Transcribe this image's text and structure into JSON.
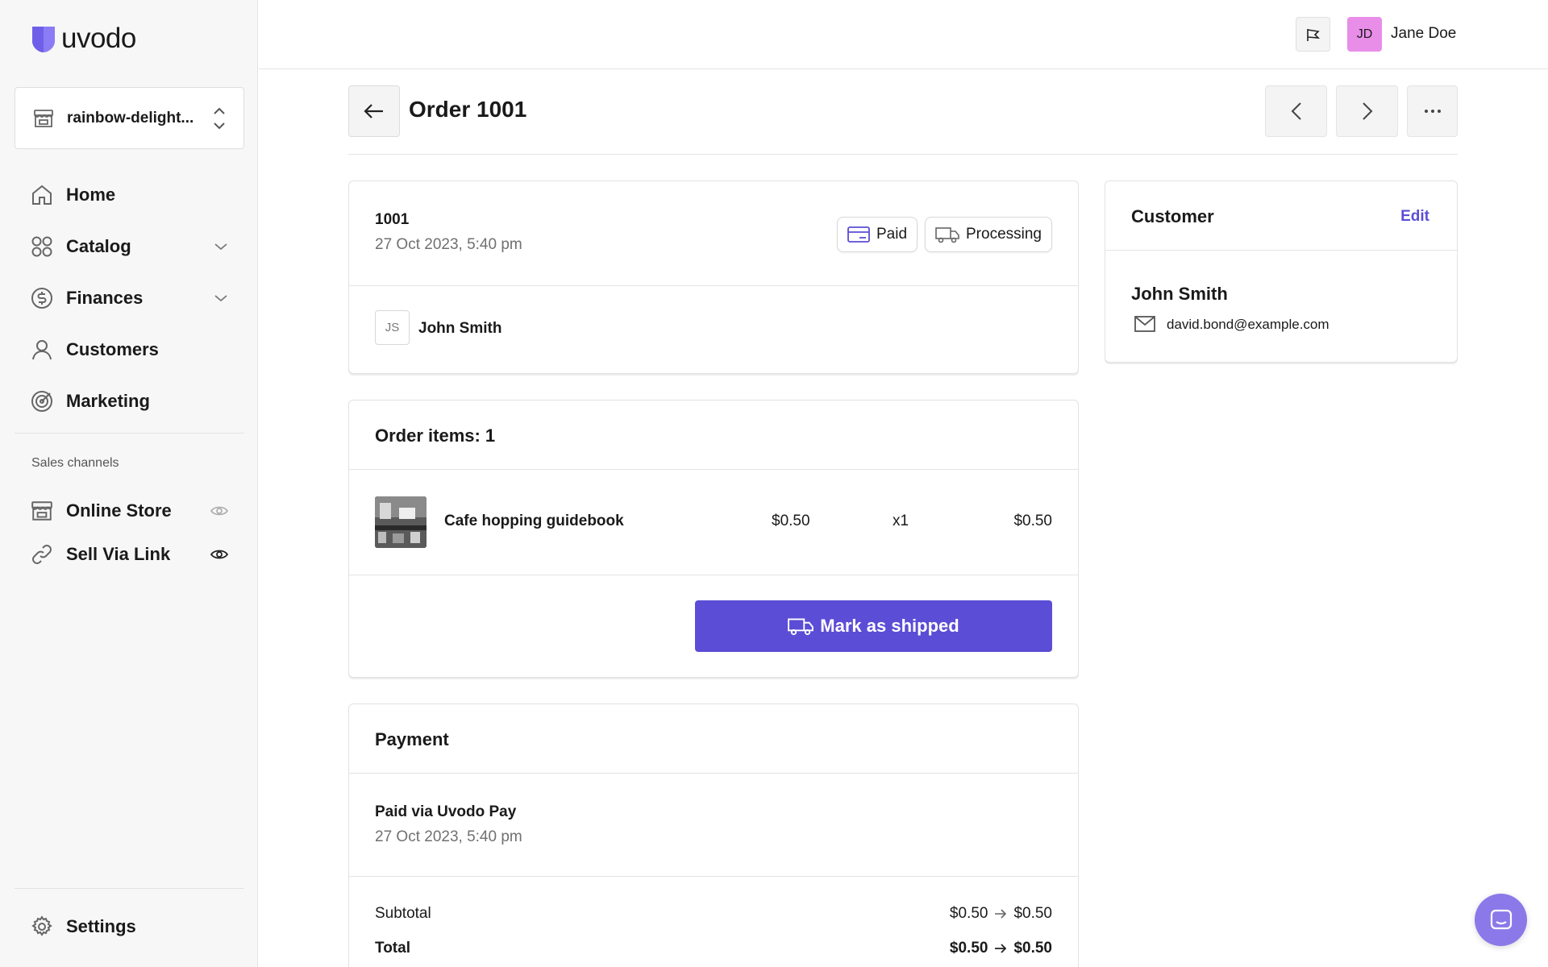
{
  "brand": {
    "name": "uvodo",
    "logo_color": "#8b7cf6"
  },
  "store": {
    "name": "rainbow-delight..."
  },
  "nav": {
    "items": [
      {
        "label": "Home",
        "icon": "home-icon"
      },
      {
        "label": "Catalog",
        "icon": "catalog-icon",
        "expandable": true
      },
      {
        "label": "Finances",
        "icon": "dollar-icon",
        "expandable": true
      },
      {
        "label": "Customers",
        "icon": "user-icon"
      },
      {
        "label": "Marketing",
        "icon": "target-icon"
      }
    ],
    "section_label": "Sales channels",
    "channels": [
      {
        "label": "Online Store",
        "icon": "storefront-icon",
        "visibility_icon": "eye-icon"
      },
      {
        "label": "Sell Via Link",
        "icon": "link-icon",
        "visibility_icon": "eye-icon"
      }
    ],
    "settings_label": "Settings"
  },
  "topbar": {
    "avatar_initials": "JD",
    "user_name": "Jane Doe",
    "avatar_color": "#e88ee8"
  },
  "order": {
    "title": "Order 1001",
    "number": "1001",
    "date": "27 Oct 2023, 5:40 pm",
    "payment_status": "Paid",
    "fulfillment_status": "Processing",
    "customer_initials": "JS",
    "customer_name": "John Smith"
  },
  "items_card": {
    "title": "Order items: 1",
    "items": [
      {
        "name": "Cafe hopping guidebook",
        "price": "$0.50",
        "qty": "x1",
        "total": "$0.50"
      }
    ],
    "ship_button": "Mark as shipped"
  },
  "payment": {
    "title": "Payment",
    "method": "Paid via Uvodo Pay",
    "date": "27 Oct 2023, 5:40 pm",
    "subtotal_label": "Subtotal",
    "subtotal_from": "$0.50",
    "subtotal_to": "$0.50",
    "total_label": "Total",
    "total_from": "$0.50",
    "total_to": "$0.50"
  },
  "customer_card": {
    "title": "Customer",
    "edit_label": "Edit",
    "name": "John Smith",
    "email": "david.bond@example.com"
  },
  "colors": {
    "accent": "#5b4dd6",
    "link": "#5b4dd6"
  }
}
